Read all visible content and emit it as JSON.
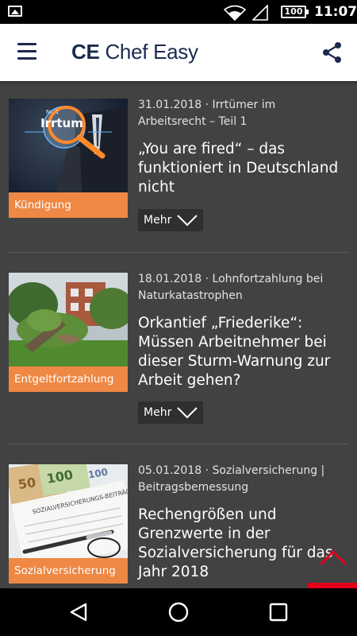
{
  "status_bar": {
    "battery": "100",
    "time": "11:07"
  },
  "app_bar": {
    "title_bold": "CE",
    "title_rest": " Chef Easy"
  },
  "articles": [
    {
      "meta": "31.01.2018 · Irrtümer im Arbeitsrecht – Teil 1",
      "headline": "„You are fired“ – das funktioniert in Deutschland nicht",
      "category": "Kündigung",
      "thumb_text": "Irrtum",
      "thumb_badge": "Nr. 1",
      "more_label": "Mehr"
    },
    {
      "meta": "18.01.2018 · Lohnfortzahlung bei Naturkatastrophen",
      "headline": "Orkantief „Friederike“: Müssen Arbeitnehmer bei dieser Sturm-Warnung zur Arbeit gehen?",
      "category": "Entgeltfortzahlung",
      "more_label": "Mehr"
    },
    {
      "meta": "05.01.2018 · Sozialversicherung | Beitragsbemessung",
      "headline": "Rechengrößen und Grenzwerte in der Sozialversicherung für das Jahr 2018",
      "category": "Sozialversicherung",
      "thumb_text": "SOZIALVERSICHERUNGS-BEITRÄGE",
      "thumb_notes": [
        "50",
        "100",
        "100"
      ]
    }
  ],
  "colors": {
    "brand_navy": "#1b2a4e",
    "category_orange": "#ee8844",
    "content_bg": "#424242",
    "accent_red": "#e3001b"
  },
  "icons": {
    "menu": "hamburger-menu-icon",
    "share": "share-icon",
    "more": "chevron-down-icon",
    "scroll_top": "chevron-up-icon",
    "nav_back": "back-triangle-icon",
    "nav_home": "home-icon",
    "nav_recents": "recents-square-icon"
  }
}
